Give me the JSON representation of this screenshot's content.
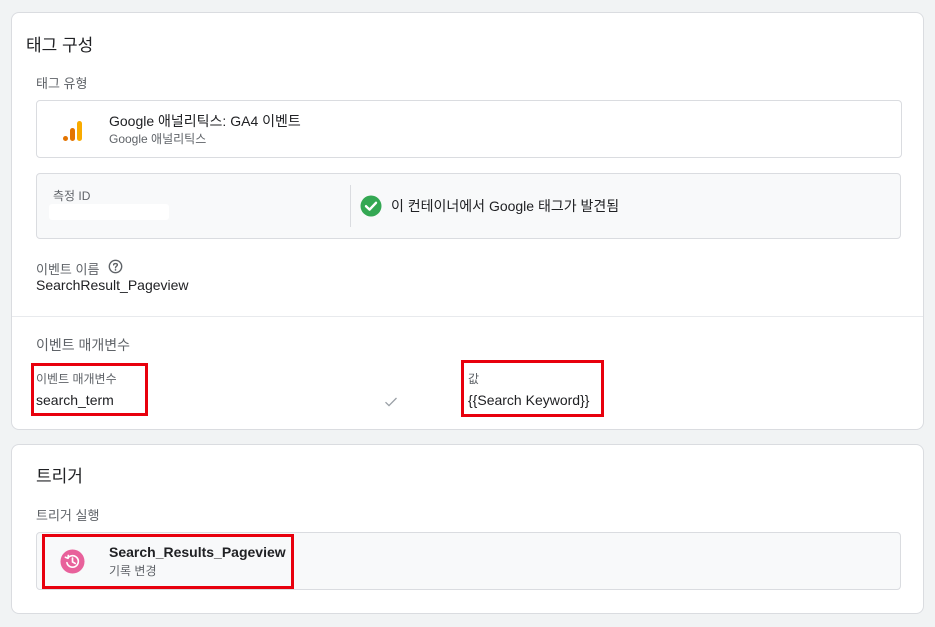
{
  "tag_config": {
    "title": "태그 구성",
    "tag_type_label": "태그 유형",
    "tag_type": {
      "name": "Google 애널리틱스: GA4 이벤트",
      "subtitle": "Google 애널리틱스",
      "icon": "google-analytics-icon"
    },
    "measurement_id": {
      "label": "측정 ID",
      "value": ""
    },
    "tag_found": {
      "text": "이 컨테이너에서 Google 태그가 발견됨",
      "icon": "check-circle-icon",
      "color": "#34a853"
    },
    "event_name": {
      "label": "이벤트 이름",
      "help_icon": "help-circle-icon",
      "value": "SearchResult_Pageview"
    },
    "event_params": {
      "section_label": "이벤트 매개변수",
      "param_header": "이벤트 매개변수",
      "value_header": "값",
      "rows": [
        {
          "param": "search_term",
          "value": "{{Search Keyword}}"
        }
      ]
    }
  },
  "trigger": {
    "title": "트리거",
    "fire_label": "트리거 실행",
    "item": {
      "name": "Search_Results_Pageview",
      "type": "기록 변경",
      "icon": "history-change-icon",
      "icon_color": "#e8619b"
    }
  },
  "highlight_color": "#e8000d"
}
